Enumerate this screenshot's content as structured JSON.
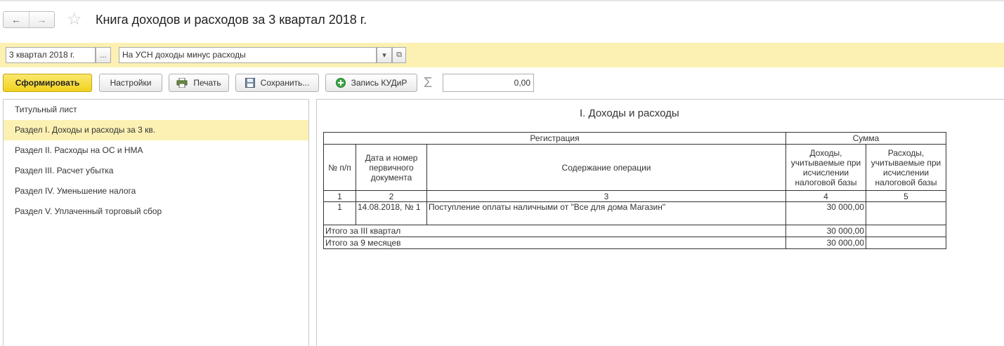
{
  "header": {
    "back_icon": "←",
    "forward_icon": "→",
    "favorite_icon": "☆",
    "title": "Книга доходов и расходов за 3 квартал 2018 г."
  },
  "params": {
    "period": "3 квартал 2018 г.",
    "period_select": "...",
    "tax_mode": "На УСН доходы минус расходы",
    "tax_mode_dropdown": "▾",
    "tax_mode_open": "⧉"
  },
  "toolbar": {
    "generate": "Сформировать",
    "settings": "Настройки",
    "print": "Печать",
    "save": "Сохранить...",
    "kudir_entry": "Запись КУДиР",
    "sigma": "Σ",
    "sum_value": "0,00"
  },
  "sections": [
    {
      "label": "Титульный лист",
      "selected": false
    },
    {
      "label": "Раздел I. Доходы и расходы за 3 кв.",
      "selected": true
    },
    {
      "label": "Раздел II. Расходы на ОС и НМА",
      "selected": false
    },
    {
      "label": "Раздел III. Расчет убытка",
      "selected": false
    },
    {
      "label": "Раздел IV. Уменьшение налога",
      "selected": false
    },
    {
      "label": "Раздел V. Уплаченный торговый сбор",
      "selected": false
    }
  ],
  "report": {
    "title": "I. Доходы и расходы",
    "group_headers": {
      "registration": "Регистрация",
      "sum": "Сумма"
    },
    "columns": {
      "num": "№ п/п",
      "doc": "Дата и номер первичного документа",
      "content": "Содержание операции",
      "income": "Доходы, учитываемые при исчислении налоговой базы",
      "expense": "Расходы, учитываемые при исчислении налоговой базы"
    },
    "column_numbers": [
      "1",
      "2",
      "3",
      "4",
      "5"
    ],
    "rows": [
      {
        "num": "1",
        "doc": "14.08.2018, № 1",
        "content": "Поступление оплаты наличными от \"Все для дома Магазин\"",
        "income": "30 000,00",
        "expense": ""
      }
    ],
    "totals": [
      {
        "label": "Итого за III квартал",
        "income": "30 000,00",
        "expense": ""
      },
      {
        "label": "Итого за 9 месяцев",
        "income": "30 000,00",
        "expense": ""
      }
    ]
  },
  "colors": {
    "accent_yellow": "#fcf1b3",
    "primary_button": "#f2d21c",
    "border": "#c8c8c8"
  }
}
